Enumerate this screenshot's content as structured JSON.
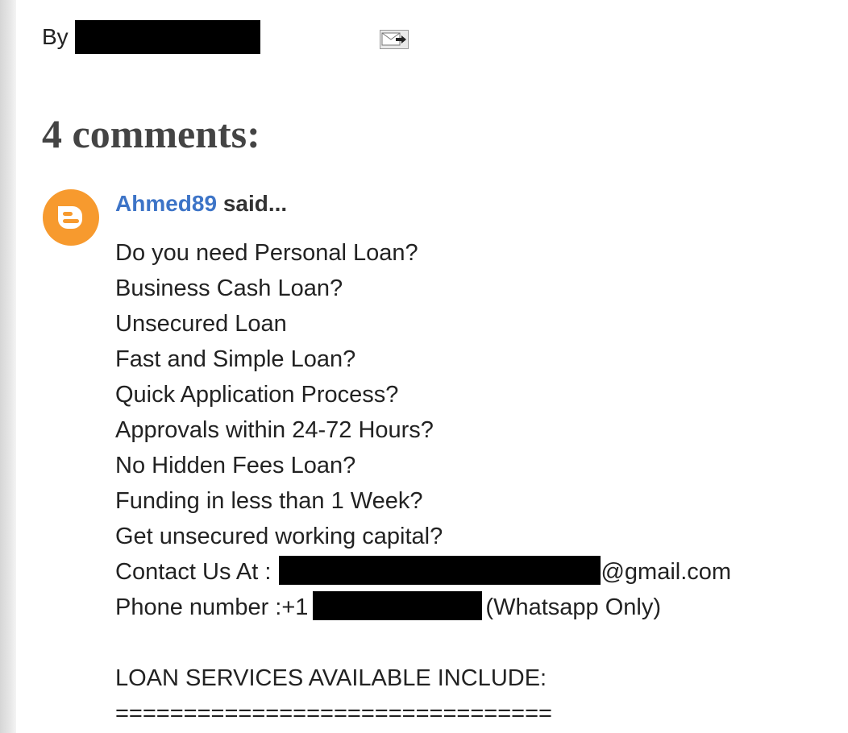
{
  "byline": {
    "label": "By",
    "email_icon": "email-post-icon"
  },
  "comments": {
    "heading": "4 comments:",
    "items": [
      {
        "author": "Ahmed89",
        "said": "said...",
        "avatar_icon": "blogger-avatar-icon",
        "avatar_color": "#f79a2e",
        "author_color": "#3d74c7",
        "lines": [
          "Do you need Personal Loan?",
          "Business Cash Loan?",
          "Unsecured Loan",
          "Fast and Simple Loan?",
          "Quick Application Process?",
          "Approvals within 24-72 Hours?",
          "No Hidden Fees Loan?",
          "Funding in less than 1 Week?",
          "Get unsecured working capital?"
        ],
        "contact_prefix": "Contact Us At : ",
        "contact_suffix": "@gmail.com",
        "phone_prefix": "Phone number :+1",
        "phone_suffix": "(Whatsapp Only)",
        "services_heading": "LOAN SERVICES AVAILABLE INCLUDE:",
        "divider": "================================"
      }
    ]
  }
}
